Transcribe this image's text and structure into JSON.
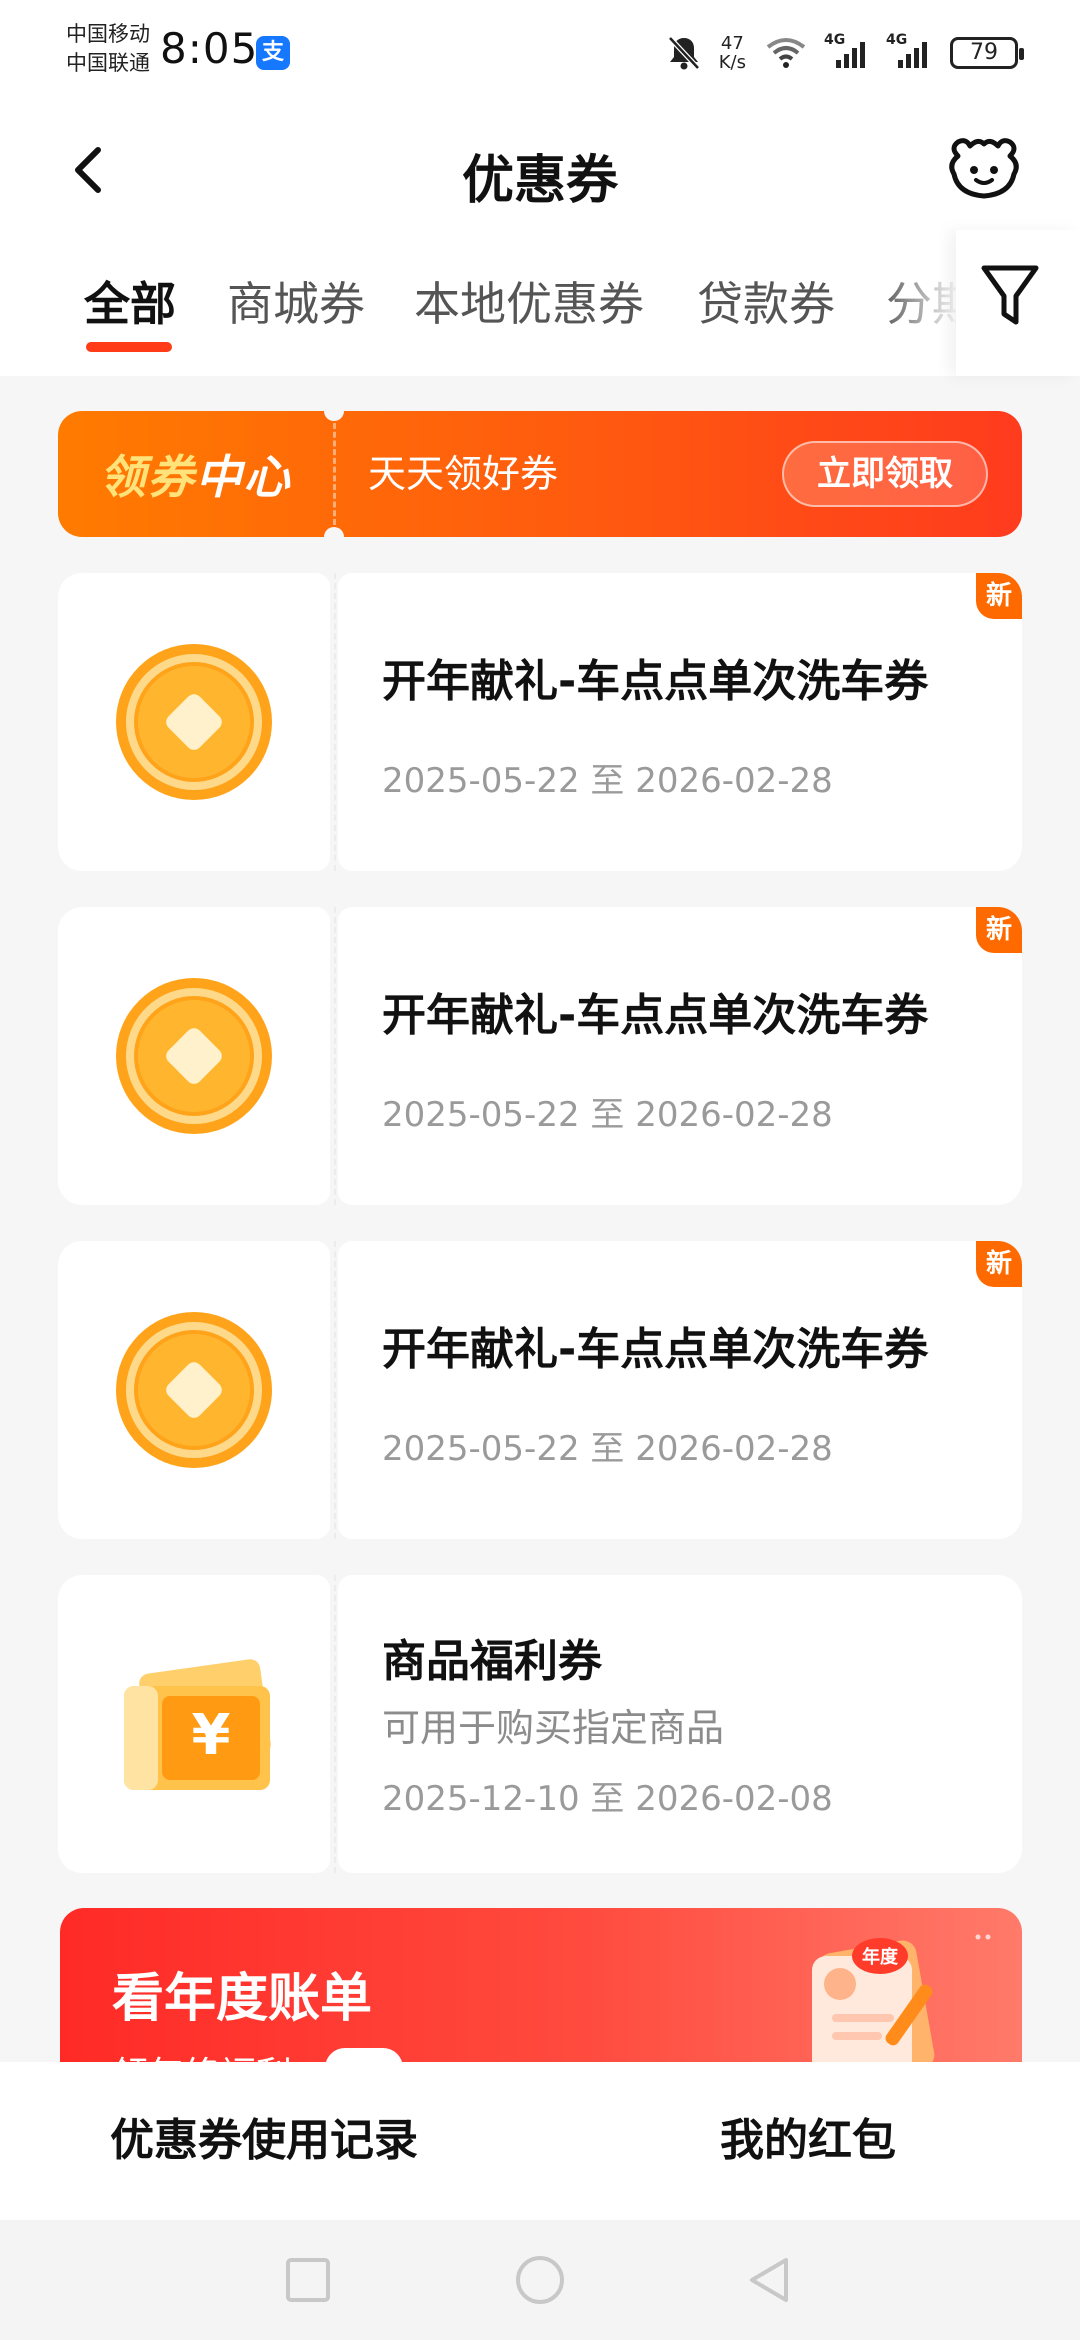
{
  "status_bar": {
    "carrier_1": "中国移动",
    "carrier_2": "中国联通",
    "time": "8:05",
    "app_badge": "支",
    "net_speed_value": "47",
    "net_speed_unit": "K/s",
    "signal_1": "4G",
    "signal_2": "4G",
    "battery": "79"
  },
  "header": {
    "title": "优惠券"
  },
  "tabs": [
    {
      "label": "全部"
    },
    {
      "label": "商城券"
    },
    {
      "label": "本地优惠券"
    },
    {
      "label": "贷款券"
    },
    {
      "label": "分期"
    }
  ],
  "banner": {
    "title_a": "领券",
    "title_b": "中心",
    "subtitle": "天天领好券",
    "button": "立即领取"
  },
  "coupons": [
    {
      "title": "开年献礼-车点点单次洗车券",
      "date": "2025-05-22 至 2026-02-28",
      "badge": "新"
    },
    {
      "title": "开年献礼-车点点单次洗车券",
      "date": "2025-05-22 至 2026-02-28",
      "badge": "新"
    },
    {
      "title": "开年献礼-车点点单次洗车券",
      "date": "2025-05-22 至 2026-02-28",
      "badge": "新"
    },
    {
      "title": "商品福利券",
      "desc": "可用于购买指定商品",
      "date": "2025-12-10 至 2026-02-08"
    }
  ],
  "annual": {
    "title": "看年度账单",
    "subtitle": "领年终福利",
    "art_label": "年度"
  },
  "bottom": {
    "left": "优惠券使用记录",
    "right": "我的红包"
  },
  "colors": {
    "accent": "#ff5a0f",
    "tab_indicator": "#ff3c17",
    "coin": "#ffb01f",
    "annual_red": "#ff2a26"
  }
}
